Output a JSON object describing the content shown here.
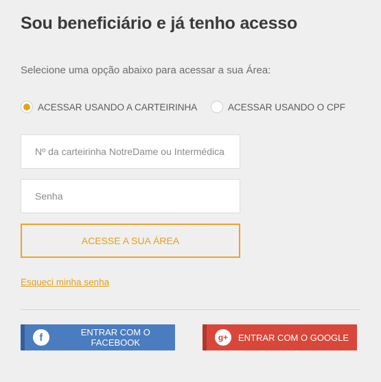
{
  "header": {
    "title": "Sou beneficiário e já tenho acesso",
    "subtitle": "Selecione uma opção abaixo para acessar a sua Área:"
  },
  "access_options": [
    {
      "label": "ACESSAR USANDO A CARTEIRINHA",
      "selected": true
    },
    {
      "label": "ACESSAR USANDO O CPF",
      "selected": false
    }
  ],
  "form": {
    "card_placeholder": "Nº da carteirinha NotreDame ou Intermédica",
    "card_value": "",
    "password_placeholder": "Senha",
    "password_value": "",
    "submit_label": "ACESSE A SUA ÁREA",
    "forgot_label": "Esqueci minha senha"
  },
  "social": {
    "facebook_label": "ENTRAR COM O FACEBOOK",
    "facebook_icon": "f",
    "google_label": "ENTRAR COM O GOOGLE",
    "google_icon": "g+"
  },
  "colors": {
    "accent": "#e3a019",
    "facebook": "#4a7cc0",
    "google": "#d9473a",
    "background": "#efefef"
  }
}
